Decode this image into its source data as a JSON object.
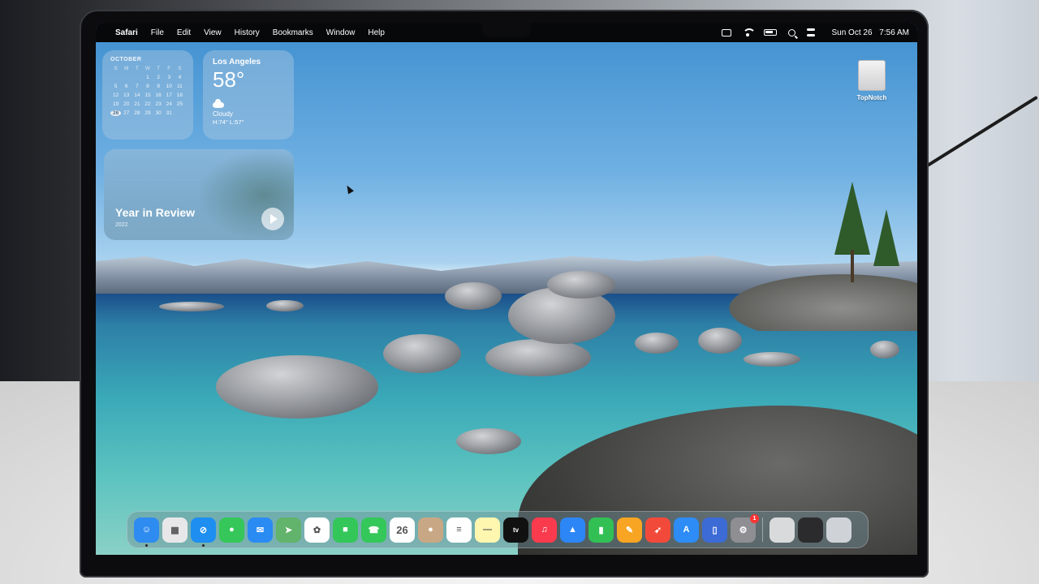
{
  "menubar": {
    "apple": "",
    "items": [
      "Safari",
      "File",
      "Edit",
      "View",
      "History",
      "Bookmarks",
      "Window",
      "Help"
    ],
    "date": "Sun Oct 26",
    "time": "7:56 AM"
  },
  "calendar_widget": {
    "month": "OCTOBER",
    "headers": [
      "S",
      "M",
      "T",
      "W",
      "T",
      "F",
      "S"
    ],
    "days": [
      "",
      "",
      "",
      "1",
      "2",
      "3",
      "4",
      "5",
      "6",
      "7",
      "8",
      "9",
      "10",
      "11",
      "12",
      "13",
      "14",
      "15",
      "16",
      "17",
      "18",
      "19",
      "20",
      "21",
      "22",
      "23",
      "24",
      "25",
      "26",
      "27",
      "28",
      "29",
      "30",
      "31",
      ""
    ],
    "today": "26"
  },
  "weather_widget": {
    "city": "Los Angeles",
    "temp": "58°",
    "condition": "Cloudy",
    "high_low": "H:74° L:57°"
  },
  "memories_widget": {
    "title": "Year in Review",
    "year": "2022"
  },
  "desktop": {
    "drive_name": "TopNotch"
  },
  "dock": {
    "apps": [
      {
        "name": "finder",
        "color": "#2e8bf0",
        "glyph": "☺",
        "running": true
      },
      {
        "name": "launchpad",
        "color": "#e7e7ea",
        "glyph": "▦",
        "running": false
      },
      {
        "name": "safari",
        "color": "#1e8ff0",
        "glyph": "⊘",
        "running": true
      },
      {
        "name": "messages",
        "color": "#35c759",
        "glyph": "●",
        "running": false
      },
      {
        "name": "mail",
        "color": "#2a8cf3",
        "glyph": "✉",
        "running": false
      },
      {
        "name": "maps",
        "color": "#62b36b",
        "glyph": "➤",
        "running": false
      },
      {
        "name": "photos",
        "color": "#ffffff",
        "glyph": "✿",
        "running": false
      },
      {
        "name": "facetime",
        "color": "#33c759",
        "glyph": "■",
        "running": false
      },
      {
        "name": "phone",
        "color": "#34c759",
        "glyph": "☎",
        "running": false
      },
      {
        "name": "calendar",
        "color": "#ffffff",
        "glyph": "26",
        "running": false
      },
      {
        "name": "contacts",
        "color": "#c8a884",
        "glyph": "●",
        "running": false
      },
      {
        "name": "reminders",
        "color": "#ffffff",
        "glyph": "≡",
        "running": false
      },
      {
        "name": "notes",
        "color": "#fff6b0",
        "glyph": "—",
        "running": false
      },
      {
        "name": "tv",
        "color": "#111111",
        "glyph": "tv",
        "running": false
      },
      {
        "name": "music",
        "color": "#fa3b4e",
        "glyph": "♫",
        "running": false
      },
      {
        "name": "keynote",
        "color": "#2d86f5",
        "glyph": "▲",
        "running": false
      },
      {
        "name": "numbers",
        "color": "#32c055",
        "glyph": "▮",
        "running": false
      },
      {
        "name": "pages",
        "color": "#f7a522",
        "glyph": "✎",
        "running": false
      },
      {
        "name": "rocket-typist",
        "color": "#f24a3a",
        "glyph": "➶",
        "running": false
      },
      {
        "name": "app-store",
        "color": "#2d8cf5",
        "glyph": "A",
        "running": false
      },
      {
        "name": "simulator",
        "color": "#3c6bd6",
        "glyph": "▯",
        "running": false
      },
      {
        "name": "system-settings",
        "color": "#8e8e93",
        "glyph": "⚙",
        "running": false,
        "badge": "1"
      }
    ],
    "right": [
      {
        "name": "drive",
        "color": "#d9dadc",
        "glyph": ""
      },
      {
        "name": "downloads-stack",
        "color": "#2b2b2e",
        "glyph": ""
      },
      {
        "name": "trash",
        "color": "#cfd3d8",
        "glyph": ""
      }
    ]
  }
}
